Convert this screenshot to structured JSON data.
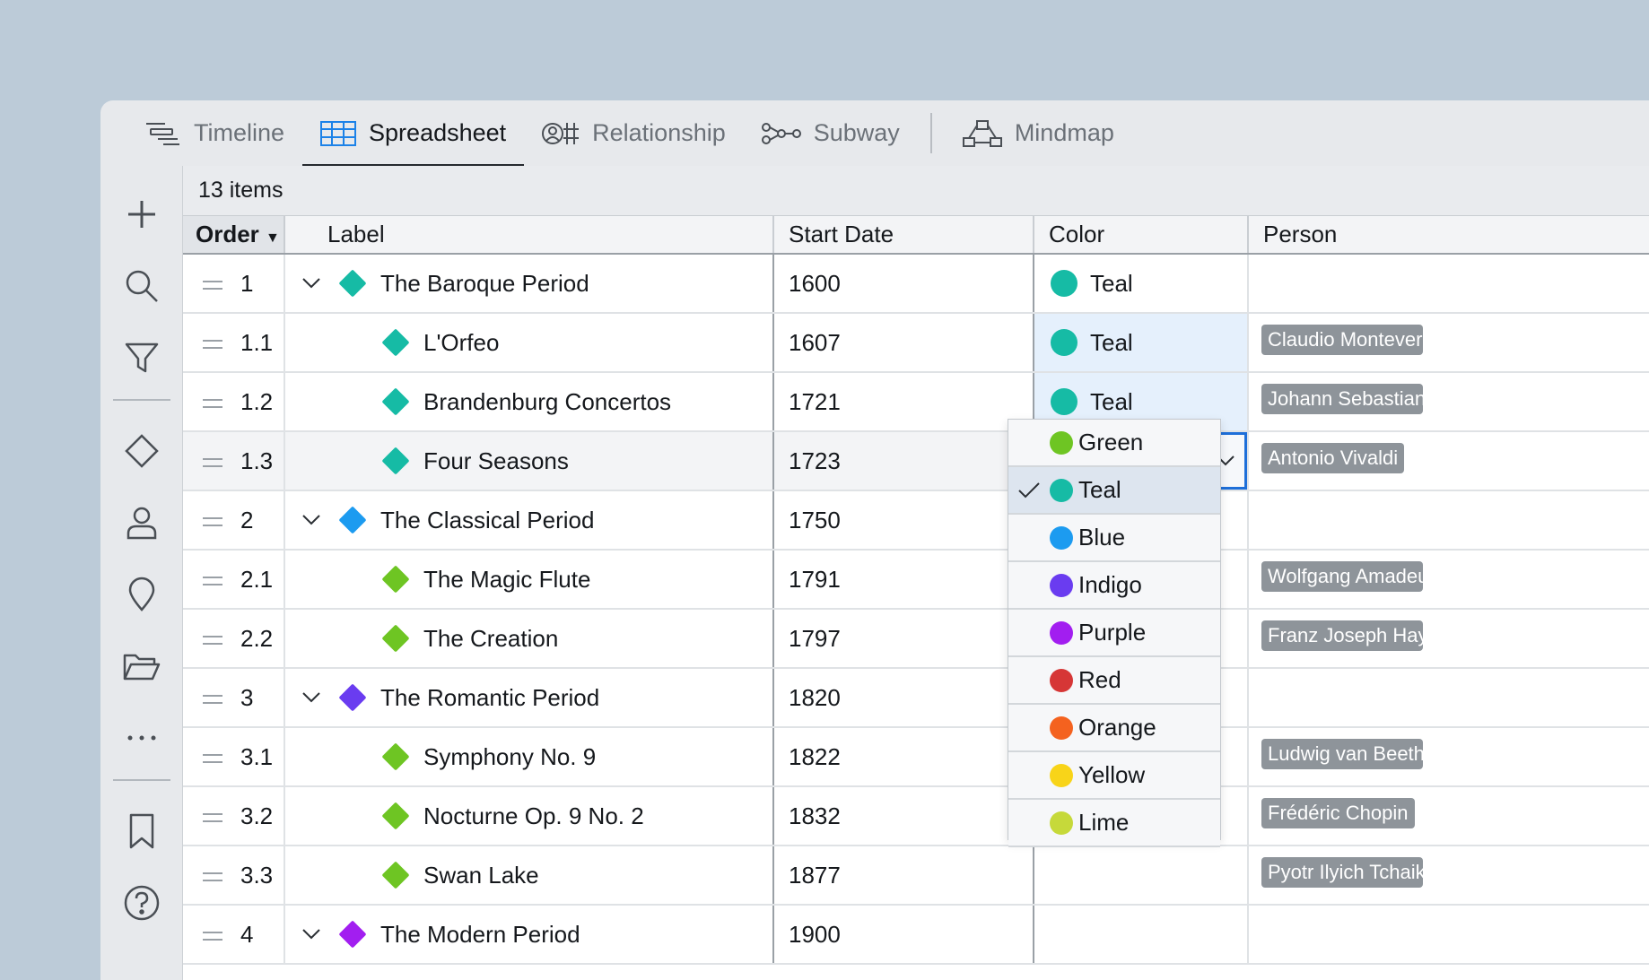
{
  "tabs": [
    {
      "label": "Timeline",
      "icon": "timeline-icon",
      "active": false
    },
    {
      "label": "Spreadsheet",
      "icon": "spreadsheet-icon",
      "active": true
    },
    {
      "label": "Relationship",
      "icon": "relationship-icon",
      "active": false
    },
    {
      "label": "Subway",
      "icon": "subway-icon",
      "active": false
    },
    {
      "label": "Mindmap",
      "icon": "mindmap-icon",
      "active": false
    }
  ],
  "sidebar": [
    "add-icon",
    "search-icon",
    "filter-icon",
    "diamond-icon",
    "person-icon",
    "location-icon",
    "folder-icon",
    "more-icon",
    "bookmark-icon",
    "help-icon"
  ],
  "item_count": "13 items",
  "columns": {
    "order": "Order",
    "label": "Label",
    "start_date": "Start Date",
    "color": "Color",
    "person": "Person"
  },
  "colors": {
    "Teal": "#16bba5",
    "Blue": "#1c9bf0",
    "Green": "#6ec523",
    "Indigo": "#6a3cf0",
    "Purple": "#a21ef0",
    "Red": "#d63636",
    "Orange": "#f4621f",
    "Yellow": "#f8d419",
    "Lime": "#c6d93a"
  },
  "rows": [
    {
      "order": "1",
      "label": "The Baroque Period",
      "start": "1600",
      "color": "Teal",
      "person": "",
      "parent": true,
      "marker": "#16bba5"
    },
    {
      "order": "1.1",
      "label": "L'Orfeo",
      "start": "1607",
      "color": "Teal",
      "person": "Claudio Monteverdi",
      "parent": false,
      "marker": "#16bba5"
    },
    {
      "order": "1.2",
      "label": "Brandenburg Concertos",
      "start": "1721",
      "color": "Teal",
      "person": "Johann Sebastian Bach",
      "parent": false,
      "marker": "#16bba5"
    },
    {
      "order": "1.3",
      "label": "Four Seasons",
      "start": "1723",
      "color": "Teal",
      "person": "Antonio Vivaldi",
      "parent": false,
      "marker": "#16bba5"
    },
    {
      "order": "2",
      "label": "The Classical Period",
      "start": "1750",
      "color": "",
      "person": "",
      "parent": true,
      "marker": "#1c9bf0"
    },
    {
      "order": "2.1",
      "label": "The Magic Flute",
      "start": "1791",
      "color": "",
      "person": "Wolfgang Amadeus Mozart",
      "parent": false,
      "marker": "#6ec523"
    },
    {
      "order": "2.2",
      "label": "The Creation",
      "start": "1797",
      "color": "",
      "person": "Franz Joseph Haydn",
      "parent": false,
      "marker": "#6ec523"
    },
    {
      "order": "3",
      "label": "The Romantic Period",
      "start": "1820",
      "color": "",
      "person": "",
      "parent": true,
      "marker": "#6a3cf0"
    },
    {
      "order": "3.1",
      "label": "Symphony No. 9",
      "start": "1822",
      "color": "",
      "person": "Ludwig van Beethoven",
      "parent": false,
      "marker": "#6ec523"
    },
    {
      "order": "3.2",
      "label": "Nocturne Op. 9 No. 2",
      "start": "1832",
      "color": "",
      "person": "Frédéric Chopin",
      "parent": false,
      "marker": "#6ec523"
    },
    {
      "order": "3.3",
      "label": "Swan Lake",
      "start": "1877",
      "color": "",
      "person": "Pyotr Ilyich Tchaikovsky",
      "parent": false,
      "marker": "#6ec523"
    },
    {
      "order": "4",
      "label": "The Modern Period",
      "start": "1900",
      "color": "",
      "person": "",
      "parent": true,
      "marker": "#a21ef0"
    }
  ],
  "dropdown": {
    "selected": "Teal",
    "options": [
      "Green",
      "Teal",
      "Blue",
      "Indigo",
      "Purple",
      "Red",
      "Orange",
      "Yellow",
      "Lime"
    ]
  }
}
